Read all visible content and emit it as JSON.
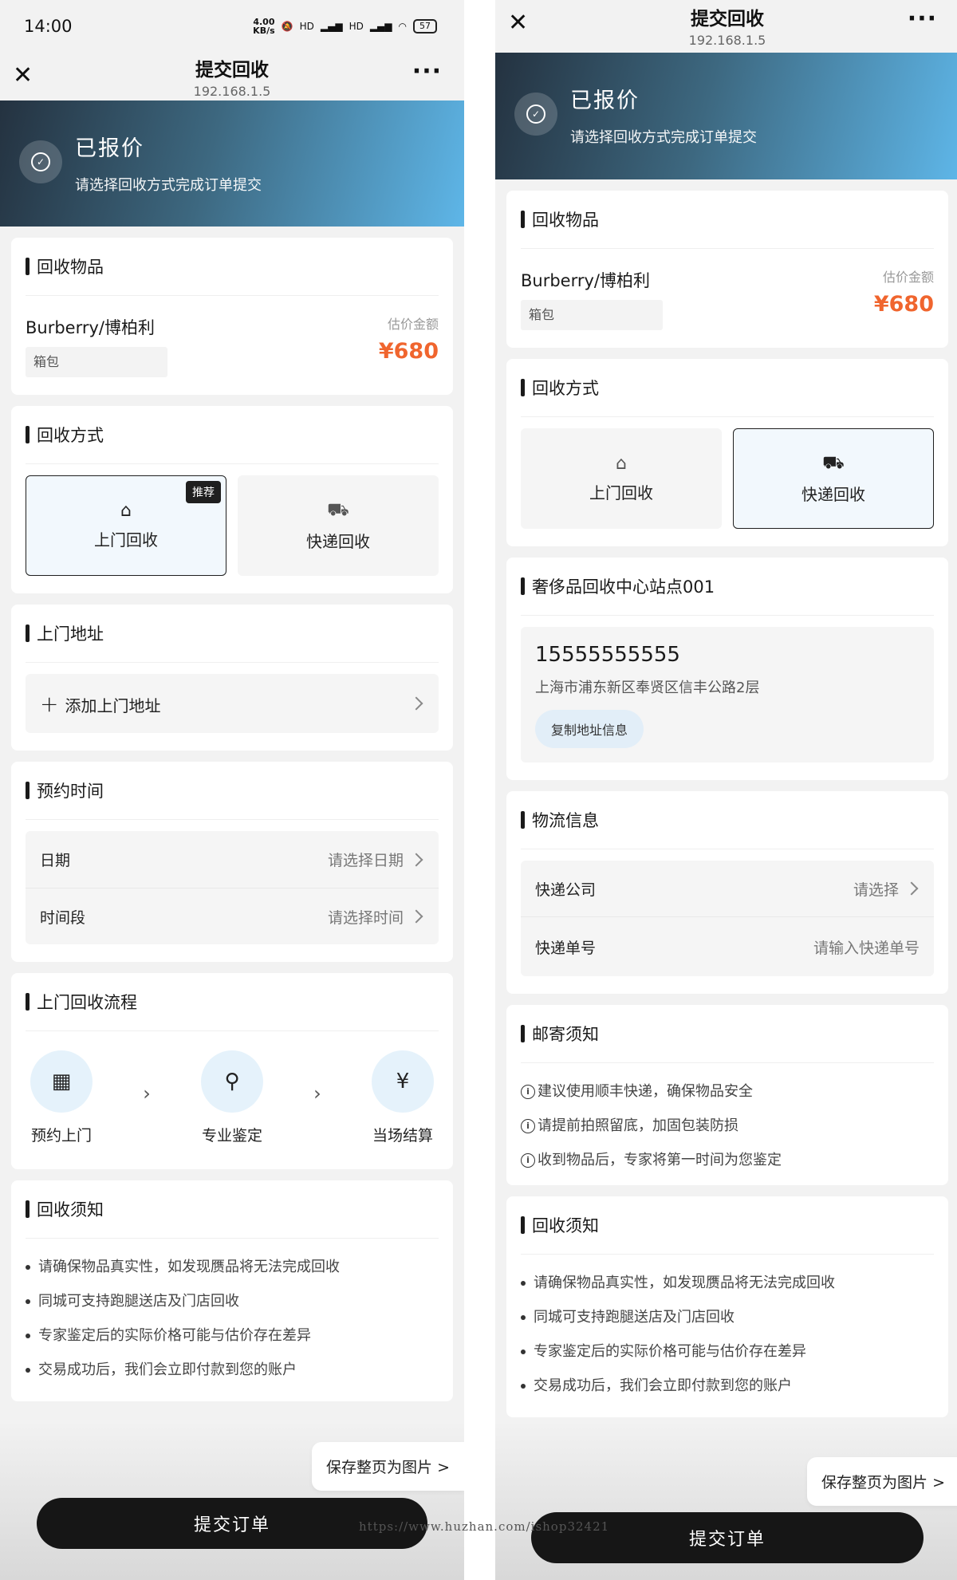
{
  "status_bar": {
    "time": "14:00",
    "speed_value": "4.00",
    "speed_unit": "KB/s",
    "signal1": "HD",
    "signal2": "HD",
    "battery": "57"
  },
  "nav": {
    "left_title": "提交回收",
    "right_title": "提交回收",
    "subtitle": "192.168.1.5"
  },
  "banner": {
    "title": "已报价",
    "desc": "请选择回收方式完成订单提交"
  },
  "item_card": {
    "header": "回收物品",
    "name": "Burberry/博柏利",
    "tag": "箱包",
    "price_label": "估价金额",
    "price": "¥680"
  },
  "method_card": {
    "header": "回收方式",
    "door_label": "上门回收",
    "express_label": "快递回收",
    "recommend_badge": "推荐"
  },
  "address_card": {
    "header": "上门地址",
    "add_label": "添加上门地址"
  },
  "schedule_card": {
    "header": "预约时间",
    "date_label": "日期",
    "date_placeholder": "请选择日期",
    "time_label": "时间段",
    "time_placeholder": "请选择时间"
  },
  "process_card": {
    "header": "上门回收流程",
    "steps": [
      "预约上门",
      "专业鉴定",
      "当场结算"
    ]
  },
  "notice_card": {
    "header": "回收须知",
    "items": [
      "请确保物品真实性，如发现赝品将无法完成回收",
      "同城可支持跑腿送店及门店回收",
      "专家鉴定后的实际价格可能与估价存在差异",
      "交易成功后，我们会立即付款到您的账户"
    ]
  },
  "station_card": {
    "header": "奢侈品回收中心站点001",
    "phone": "15555555555",
    "address": "上海市浦东新区奉贤区信丰公路2层",
    "copy_label": "复制地址信息"
  },
  "logistics_card": {
    "header": "物流信息",
    "company_label": "快递公司",
    "company_placeholder": "请选择",
    "tracking_label": "快递单号",
    "tracking_placeholder": "请输入快递单号"
  },
  "mail_card": {
    "header": "邮寄须知",
    "items": [
      "建议使用顺丰快递，确保物品安全",
      "请提前拍照留底，加固包装防损",
      "收到物品后，专家将第一时间为您鉴定"
    ]
  },
  "footer": {
    "save_image": "保存整页为图片 >",
    "submit": "提交订单"
  },
  "watermark": "https://www.huzhan.com/ishop32421",
  "colors": {
    "accent_price": "#f0652e",
    "primary_dark": "#161616",
    "step_bg": "#e5f2fb"
  }
}
